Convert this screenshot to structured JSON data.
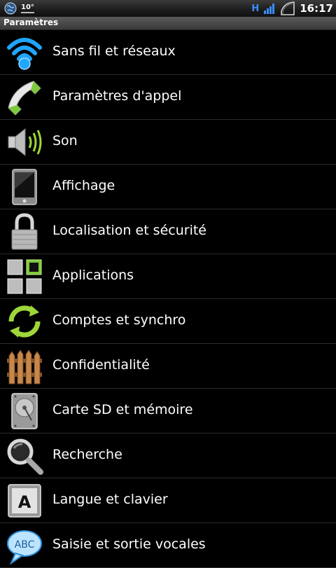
{
  "status_bar": {
    "temperature": "10°",
    "network_type": "H",
    "time": "16:17"
  },
  "header": {
    "title": "Paramètres"
  },
  "settings_items": [
    {
      "label": "Sans fil et réseaux",
      "icon": "wifi-icon"
    },
    {
      "label": "Paramètres d'appel",
      "icon": "phone-icon"
    },
    {
      "label": "Son",
      "icon": "speaker-icon"
    },
    {
      "label": "Affichage",
      "icon": "display-icon"
    },
    {
      "label": "Localisation et sécurité",
      "icon": "lock-icon"
    },
    {
      "label": "Applications",
      "icon": "applications-icon"
    },
    {
      "label": "Comptes et synchro",
      "icon": "sync-icon"
    },
    {
      "label": "Confidentialité",
      "icon": "fence-icon"
    },
    {
      "label": "Carte SD et mémoire",
      "icon": "sd-card-icon"
    },
    {
      "label": "Recherche",
      "icon": "search-icon"
    },
    {
      "label": "Langue et clavier",
      "icon": "keyboard-icon"
    },
    {
      "label": "Saisie et sortie vocales",
      "icon": "voice-bubble-icon"
    }
  ],
  "colors": {
    "background": "#000000",
    "network_indicator": "#3a8cff",
    "wifi_icon": "#1fa6ff",
    "sync_icon": "#9ed63a"
  }
}
